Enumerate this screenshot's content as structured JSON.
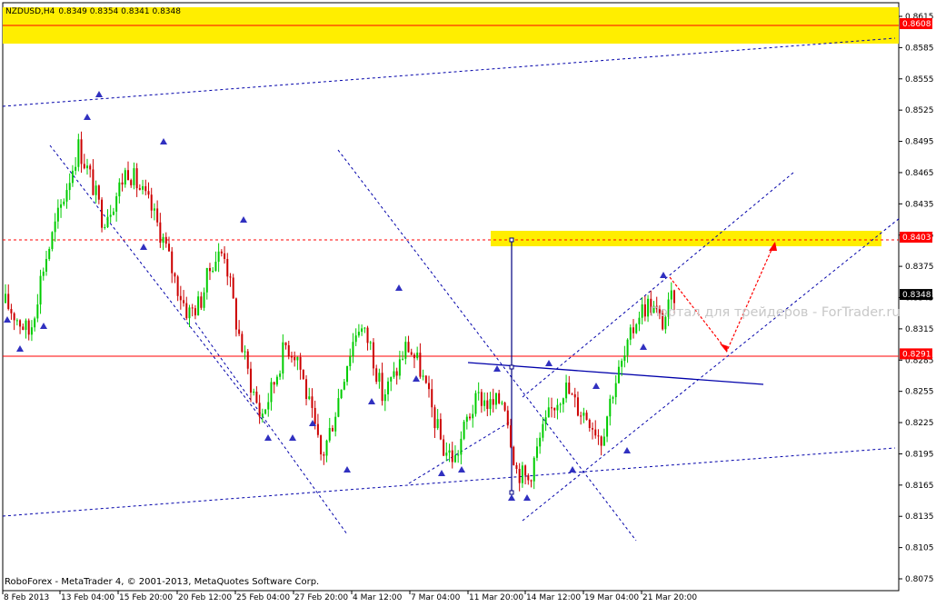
{
  "header": {
    "symbol": "NZDUSD,H4",
    "ohlc": "0.8349 0.8354 0.8341 0.8348"
  },
  "footer": {
    "copyright": "RoboForex - MetaTrader 4, © 2001-2013, MetaQuotes Software Corp."
  },
  "watermark": "Портал для трейдеров - ForTrader.ru",
  "colors": {
    "background": "#ffffff",
    "bull_candle": "#00cc00",
    "bear_candle": "#cc0000",
    "level_line": "#ff0000",
    "channel_line": "#0000aa",
    "target_zone": "#ffee00",
    "arrow_marker": "#3030c0",
    "forecast": "#ff0000"
  },
  "chart_data": {
    "type": "candlestick",
    "symbol": "NZDUSD",
    "timeframe": "H4",
    "ylim": [
      0.807,
      0.8625
    ],
    "y_ticks": [
      "0.8615",
      "0.8585",
      "0.8555",
      "0.8525",
      "0.8495",
      "0.8465",
      "0.8435",
      "0.8405",
      "0.8375",
      "0.8345",
      "0.8315",
      "0.8285",
      "0.8255",
      "0.8225",
      "0.8195",
      "0.8165",
      "0.8135",
      "0.8105",
      "0.8075"
    ],
    "x_tick_labels": [
      "8 Feb 2013",
      "13 Feb 04:00",
      "15 Feb 20:00",
      "20 Feb 12:00",
      "25 Feb 04:00",
      "27 Feb 20:00",
      "4 Mar 12:00",
      "7 Mar 04:00",
      "11 Mar 20:00",
      "14 Mar 12:00",
      "19 Mar 04:00",
      "21 Mar 20:00"
    ],
    "price_markers": [
      {
        "label": "0.8608",
        "value": 0.8608,
        "style": "red"
      },
      {
        "label": "0.8403",
        "value": 0.8403,
        "style": "red"
      },
      {
        "label": "0.8348",
        "value": 0.8348,
        "style": "black"
      },
      {
        "label": "0.8291",
        "value": 0.8291,
        "style": "red"
      }
    ],
    "close_path": [
      0.834,
      0.8325,
      0.831,
      0.837,
      0.841,
      0.845,
      0.849,
      0.846,
      0.842,
      0.844,
      0.847,
      0.845,
      0.843,
      0.84,
      0.836,
      0.833,
      0.834,
      0.838,
      0.839,
      0.832,
      0.827,
      0.823,
      0.826,
      0.83,
      0.829,
      0.824,
      0.819,
      0.823,
      0.828,
      0.832,
      0.83,
      0.825,
      0.827,
      0.83,
      0.828,
      0.824,
      0.82,
      0.819,
      0.823,
      0.825,
      0.824,
      0.825,
      0.818,
      0.817,
      0.821,
      0.824,
      0.826,
      0.824,
      0.823,
      0.821,
      0.826,
      0.829,
      0.833,
      0.834,
      0.832,
      0.8348
    ],
    "levels": [
      0.8608,
      0.8403,
      0.8291
    ]
  }
}
